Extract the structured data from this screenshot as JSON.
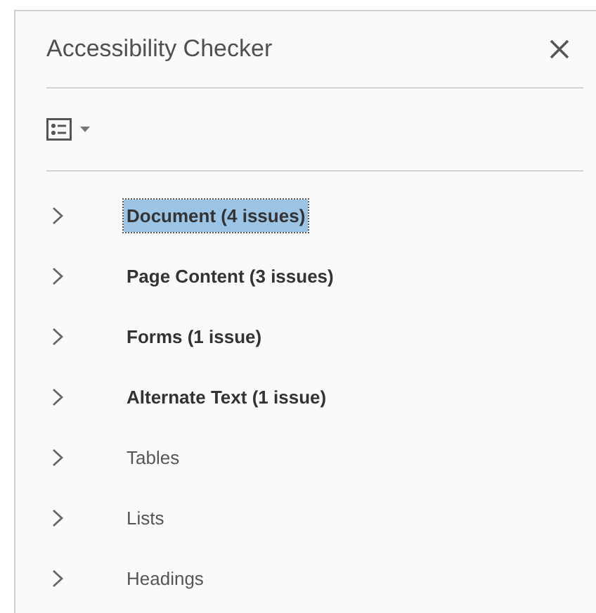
{
  "panel": {
    "title": "Accessibility Checker"
  },
  "categories": [
    {
      "label": "Document (4 issues)",
      "has_issues": true,
      "selected": true
    },
    {
      "label": "Page Content (3 issues)",
      "has_issues": true,
      "selected": false
    },
    {
      "label": "Forms (1 issue)",
      "has_issues": true,
      "selected": false
    },
    {
      "label": "Alternate Text (1 issue)",
      "has_issues": true,
      "selected": false
    },
    {
      "label": "Tables",
      "has_issues": false,
      "selected": false
    },
    {
      "label": "Lists",
      "has_issues": false,
      "selected": false
    },
    {
      "label": "Headings",
      "has_issues": false,
      "selected": false
    }
  ]
}
